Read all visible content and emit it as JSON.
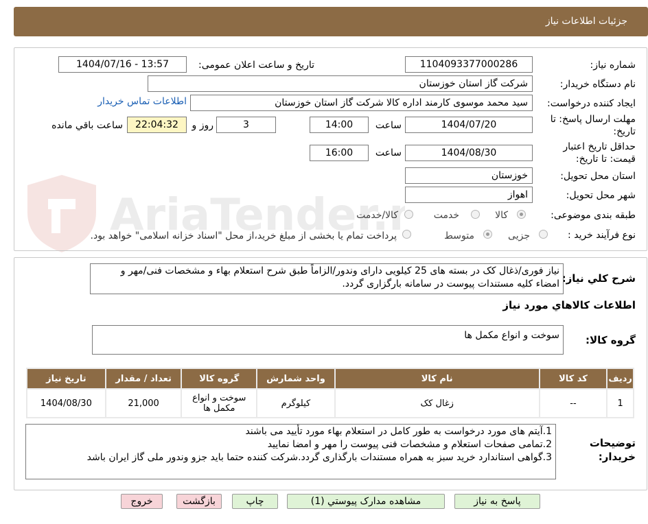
{
  "header": {
    "title": "جزئیات اطلاعات نیاز"
  },
  "watermark": {
    "text": "AriaTender.neT"
  },
  "fields": {
    "need_number": {
      "label": "شماره نیاز:",
      "value": "1104093377000286"
    },
    "announce": {
      "label": "تاریخ و ساعت اعلان عمومی:",
      "value": "1404/07/16 - 13:57"
    },
    "buyer": {
      "label": "نام دستگاه خریدار:",
      "value": "شرکت گاز استان خوزستان"
    },
    "creator": {
      "label": "ایجاد کننده درخواست:",
      "value": "سید محمد موسوی کارمند اداره کالا شرکت گاز استان خوزستان",
      "contact_link": "اطلاعات تماس خریدار"
    },
    "deadline": {
      "label": "مهلت ارسال پاسخ: تا تاریخ:",
      "date": "1404/07/20",
      "time_label": "ساعت",
      "time": "14:00",
      "days": "3",
      "days_label": "روز و",
      "remaining": "22:04:32",
      "remaining_label": "ساعت باقي مانده"
    },
    "validity": {
      "label": "حداقل تاریخ اعتبار قیمت: تا تاریخ:",
      "date": "1404/08/30",
      "time_label": "ساعت",
      "time": "16:00"
    },
    "province": {
      "label": "استان محل تحویل:",
      "value": "خوزستان"
    },
    "city": {
      "label": "شهر محل تحویل:",
      "value": "اهواز"
    },
    "category": {
      "label": "طبقه بندی موضوعی:",
      "options": [
        "کالا",
        "خدمت",
        "کالا/خدمت"
      ],
      "selected": "کالا"
    },
    "process": {
      "label": "نوع فرآیند خرید :",
      "options": [
        "جزیی",
        "متوسط"
      ],
      "selected": "متوسط",
      "note": "پرداخت تمام یا بخشی از مبلغ خرید،از محل \"اسناد خزانه اسلامی\" خواهد بود."
    }
  },
  "summary": {
    "label": "شرح کلي نياز:",
    "text": "نیاز فوری/ذغال کک در بسته های 25 کیلویی دارای وندور/الزاماً طبق شرح استعلام بهاء و مشخصات فنی/مهر و امضاء کلیه مستندات پیوست در سامانه بارگزاری گردد."
  },
  "goods_info": {
    "title": "اطلاعات کالاهاي مورد نياز",
    "group_label": "گروه کالا:",
    "group_value": "سوخت و انواع مکمل ها",
    "columns": [
      "رديف",
      "کد کالا",
      "نام کالا",
      "واحد شمارش",
      "گروه کالا",
      "تعداد / مقدار",
      "تاريخ نياز"
    ],
    "rows": [
      [
        "1",
        "--",
        "زغال کک",
        "کيلوگرم",
        "سوخت و انواع مکمل ها",
        "21,000",
        "1404/08/30"
      ]
    ]
  },
  "buyer_notes": {
    "label": "توضيحات خريدار:",
    "lines": [
      "1.آیتم های مورد درخواست به طور کامل در استعلام بهاء مورد تأیید می باشند",
      "2.تمامی صفحات استعلام و مشخصات فنی پیوست را مهر و امضا نمایید",
      "3.گواهی استاندارد خرید سبز به همراه مستندات بارگذاری گردد.شرکت کننده حتما باید جزو وندور ملی گاز ایران باشد"
    ]
  },
  "buttons": {
    "reply": "پاسخ به نياز",
    "attachments": "مشاهده مدارک پيوستي (1)",
    "print": "چاپ",
    "back": "بازگشت",
    "exit": "خروج"
  }
}
